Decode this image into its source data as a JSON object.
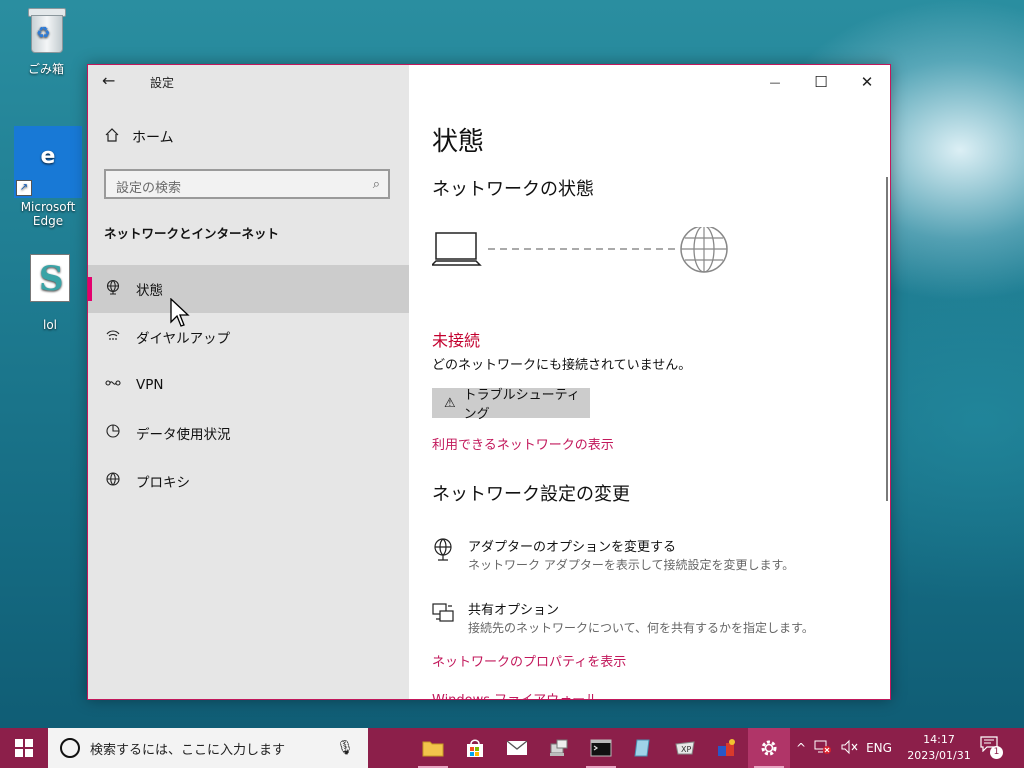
{
  "desktop": {
    "icons": [
      {
        "label": "ごみ箱"
      },
      {
        "label": "Microsoft Edge"
      },
      {
        "label": "lol"
      }
    ]
  },
  "window": {
    "app_title": "設定",
    "controls": {
      "minimize": "—",
      "maximize": "☐",
      "close": "✕"
    }
  },
  "sidebar": {
    "home": "ホーム",
    "search_placeholder": "設定の検索",
    "section_title": "ネットワークとインターネット",
    "items": [
      {
        "label": "状態",
        "icon": "globe-network-icon",
        "active": true
      },
      {
        "label": "ダイヤルアップ",
        "icon": "dialup-icon",
        "active": false
      },
      {
        "label": "VPN",
        "icon": "vpn-icon",
        "active": false
      },
      {
        "label": "データ使用状況",
        "icon": "pie-chart-icon",
        "active": false
      },
      {
        "label": "プロキシ",
        "icon": "globe-icon",
        "active": false
      }
    ]
  },
  "content": {
    "title": "状態",
    "network_status_heading": "ネットワークの状態",
    "status": "未接続",
    "status_desc": "どのネットワークにも接続されていません。",
    "troubleshoot_button": "トラブルシューティング",
    "show_networks_link": "利用できるネットワークの表示",
    "change_settings_heading": "ネットワーク設定の変更",
    "options": [
      {
        "title": "アダプターのオプションを変更する",
        "desc": "ネットワーク アダプターを表示して接続設定を変更します。",
        "icon": "adapter-icon"
      },
      {
        "title": "共有オプション",
        "desc": "接続先のネットワークについて、何を共有するかを指定します。",
        "icon": "sharing-icon"
      }
    ],
    "properties_link": "ネットワークのプロパティを表示",
    "firewall_link": "Windows ファイアウォール"
  },
  "taskbar": {
    "search_placeholder": "検索するには、ここに入力します",
    "tray_language": "ENG",
    "time": "14:17",
    "date": "2023/01/31",
    "notification_count": "1"
  },
  "colors": {
    "accent": "#e3006d",
    "link": "#c2185b",
    "status_error": "#c3002e",
    "taskbar": "#8c1f4a"
  }
}
